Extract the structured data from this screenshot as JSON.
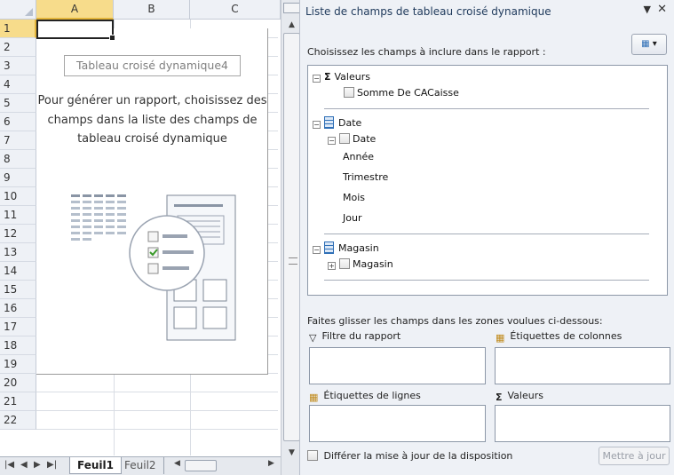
{
  "sheet": {
    "columns": [
      "A",
      "B",
      "C"
    ],
    "rows": [
      "1",
      "2",
      "3",
      "4",
      "5",
      "6",
      "7",
      "8",
      "9",
      "10",
      "11",
      "12",
      "13",
      "14",
      "15",
      "16",
      "17",
      "18",
      "19",
      "20",
      "21",
      "22"
    ],
    "pivot_title": "Tableau croisé dynamique4",
    "pivot_message": "Pour générer un rapport, choisissez des champs dans la liste des champs de tableau croisé dynamique",
    "tabs": [
      "Feuil1",
      "Feuil2"
    ]
  },
  "pane": {
    "title": "Liste de champs de tableau croisé dynamique",
    "choose_label": "Choisissez les champs à inclure dans le rapport :",
    "fields": {
      "valeurs_group": "Valeurs",
      "somme": "Somme De CACaisse",
      "date_table": "Date",
      "date_field": "Date",
      "annee": "Année",
      "trimestre": "Trimestre",
      "mois": "Mois",
      "jour": "Jour",
      "magasin_table": "Magasin",
      "magasin_field": "Magasin"
    },
    "drag_label": "Faites glisser les champs dans les zones voulues ci-dessous:",
    "zones": {
      "filter": "Filtre du rapport",
      "columns": "Étiquettes de colonnes",
      "rows": "Étiquettes de lignes",
      "values": "Valeurs"
    },
    "defer_label": "Différer la mise à jour de la disposition",
    "update_label": "Mettre à jour",
    "colors": {
      "selection": "#f7dc8b",
      "title": "#1e395b",
      "table_icon": "#2f6fb6"
    }
  }
}
